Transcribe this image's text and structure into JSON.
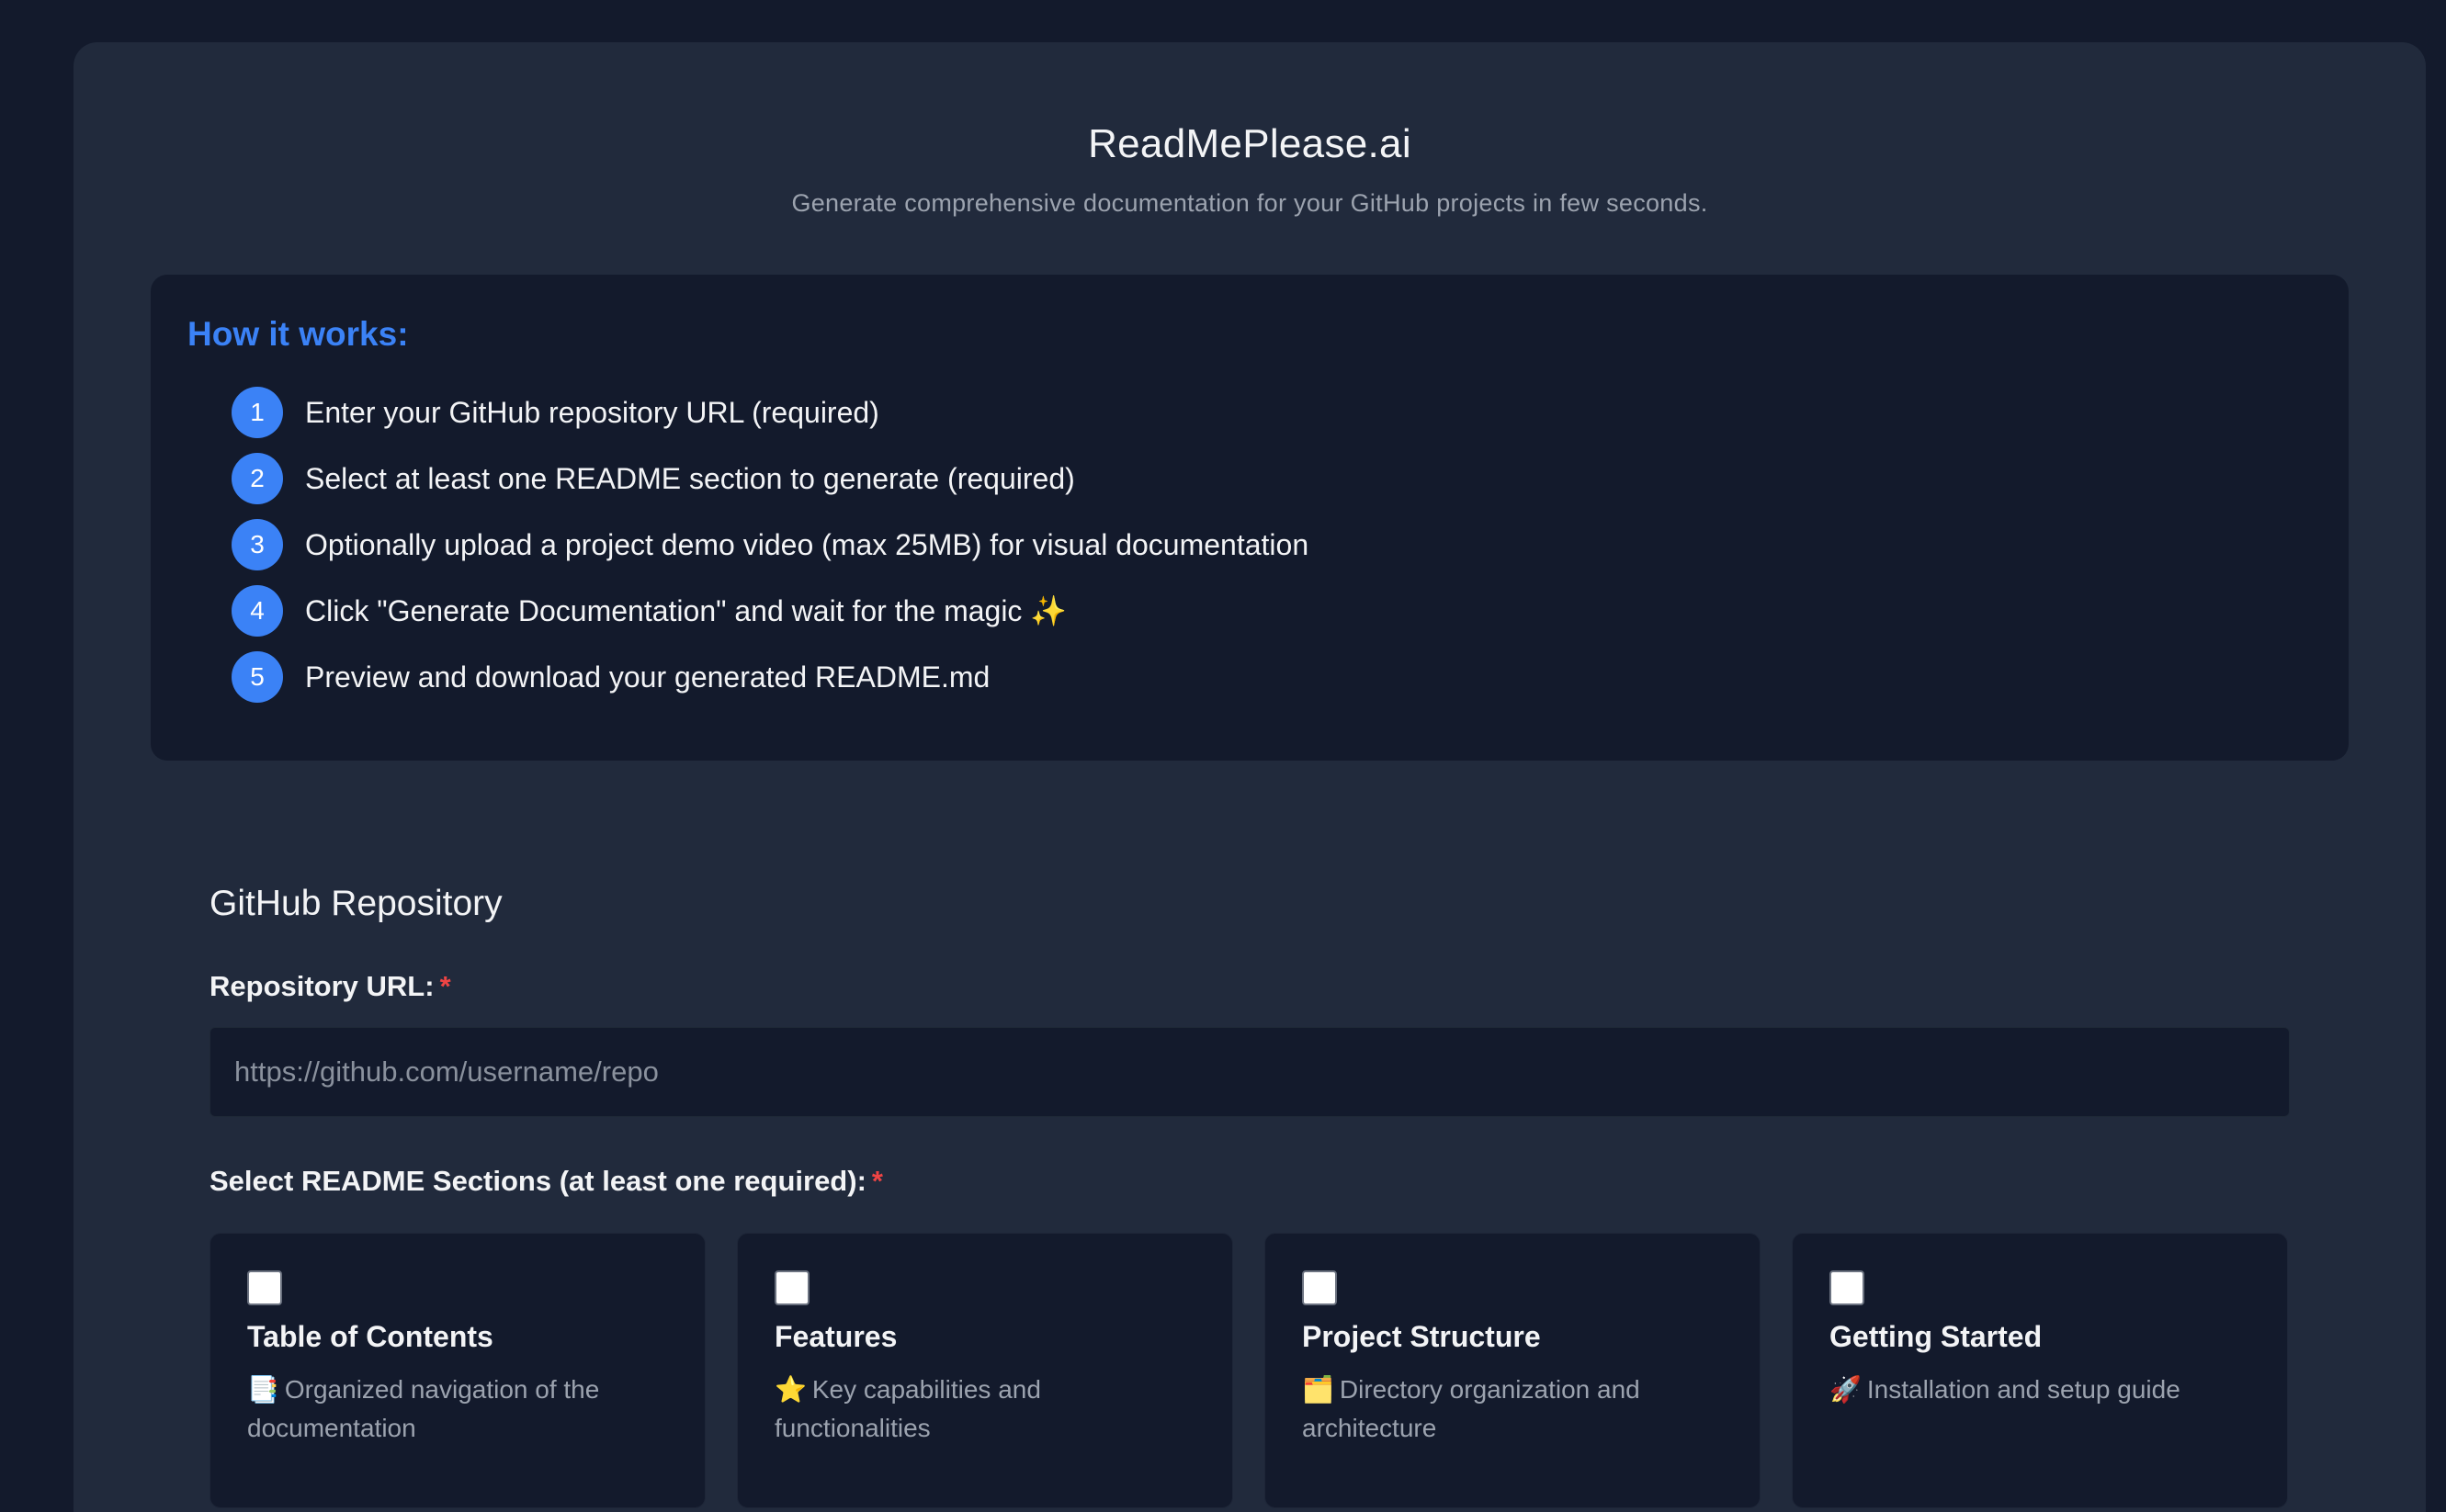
{
  "header": {
    "title": "ReadMePlease.ai",
    "subtitle": "Generate comprehensive documentation for your GitHub projects in few seconds."
  },
  "how_it_works": {
    "title": "How it works:",
    "steps": [
      {
        "num": "1",
        "text": "Enter your GitHub repository URL (required)"
      },
      {
        "num": "2",
        "text": "Select at least one README section to generate (required)"
      },
      {
        "num": "3",
        "text": "Optionally upload a project demo video (max 25MB) for visual documentation"
      },
      {
        "num": "4",
        "text": "Click \"Generate Documentation\" and wait for the magic ✨"
      },
      {
        "num": "5",
        "text": "Preview and download your generated README.md"
      }
    ]
  },
  "repo": {
    "section_title": "GitHub Repository",
    "url_label": "Repository URL:",
    "required_mark": "*",
    "url_placeholder": "https://github.com/username/repo",
    "url_value": ""
  },
  "readme_sections": {
    "label": "Select README Sections (at least one required):",
    "required_mark": "*",
    "items": [
      {
        "title": "Table of Contents",
        "emoji": "📑",
        "desc": "Organized navigation of the documentation",
        "checked": false
      },
      {
        "title": "Features",
        "emoji": "⭐",
        "desc": "Key capabilities and functionalities",
        "checked": false
      },
      {
        "title": "Project Structure",
        "emoji": "🗂️",
        "desc": "Directory organization and architecture",
        "checked": false
      },
      {
        "title": "Getting Started",
        "emoji": "🚀",
        "desc": "Installation and setup guide",
        "checked": false
      }
    ]
  },
  "colors": {
    "page_bg": "#131a2c",
    "card_bg": "#212a3c",
    "accent": "#3b82f6",
    "required": "#ef4444"
  }
}
